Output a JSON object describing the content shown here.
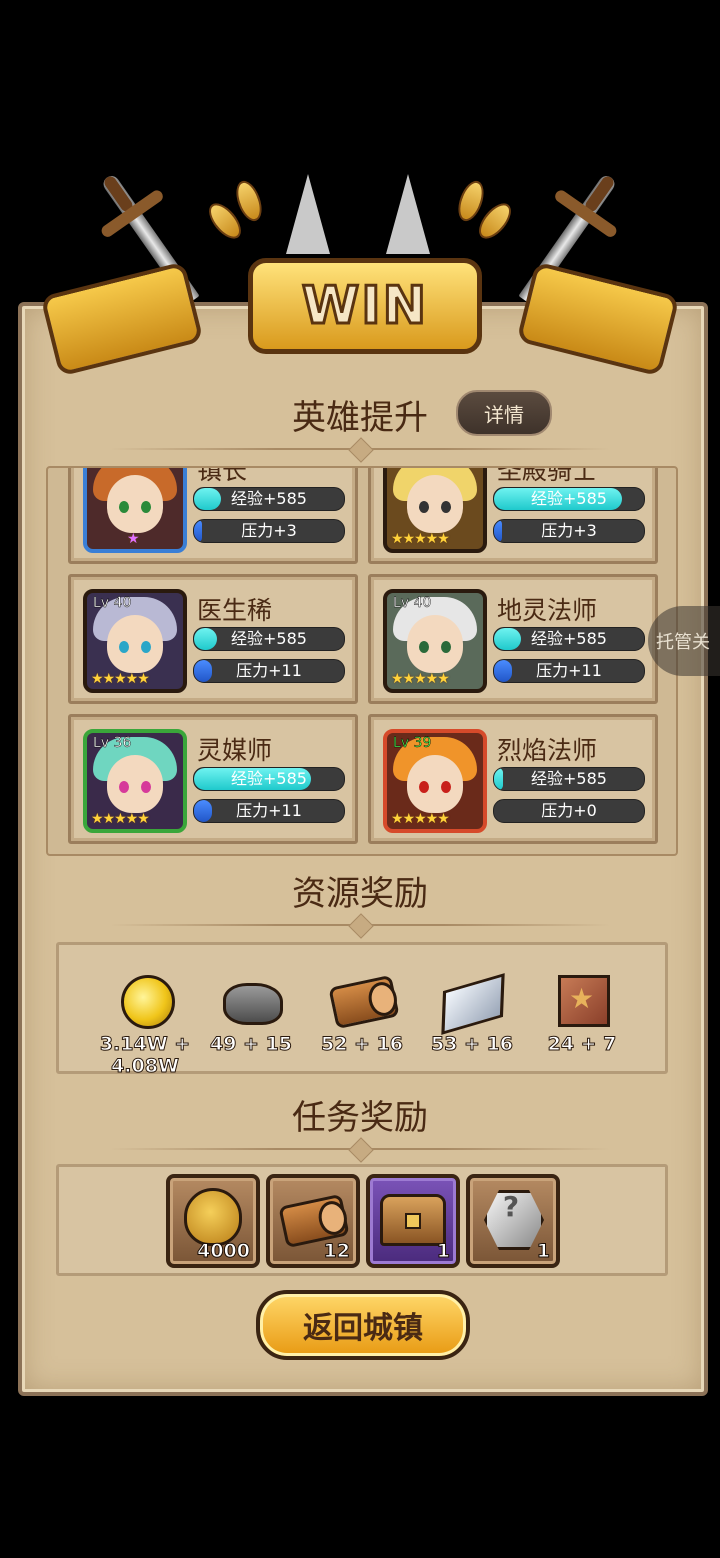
{
  "banner": {
    "title": "WIN"
  },
  "hero_section": {
    "title": "英雄提升",
    "detail_button": "详情",
    "heroes": [
      {
        "name": "镇长",
        "level": "",
        "exp": "经验+585",
        "exp_fill": 0.18,
        "pressure": "压力+3",
        "pressure_fill": 0.05,
        "stars": "★",
        "frame": "#3a7fd6",
        "hair": "#c86a2a"
      },
      {
        "name": "圣殿骑士",
        "level": "",
        "exp": "经验+585",
        "exp_fill": 0.85,
        "pressure": "压力+3",
        "pressure_fill": 0.05,
        "stars": "★★★★★",
        "frame": "#d9a020",
        "hair": "#f0d46a"
      },
      {
        "name": "医生稀",
        "level": "Lv 40",
        "exp": "经验+585",
        "exp_fill": 0.15,
        "pressure": "压力+11",
        "pressure_fill": 0.12,
        "stars": "★★★★★",
        "frame": "#2a1a0e",
        "hair": "#b9b9d4"
      },
      {
        "name": "地灵法师",
        "level": "Lv 40",
        "exp": "经验+585",
        "exp_fill": 0.18,
        "pressure": "压力+11",
        "pressure_fill": 0.12,
        "stars": "★★★★★",
        "frame": "#2a1a0e",
        "hair": "#e6e6e6"
      },
      {
        "name": "灵媒师",
        "level": "Lv 36",
        "exp": "经验+585",
        "exp_fill": 0.78,
        "pressure": "压力+11",
        "pressure_fill": 0.12,
        "stars": "★★★★★",
        "frame": "#3aa63a",
        "hair": "#6fd6c0"
      },
      {
        "name": "烈焰法师",
        "level": "Lv 39",
        "exp": "经验+585",
        "exp_fill": 0.06,
        "pressure": "压力+0",
        "pressure_fill": 0.0,
        "stars": "★★★★★",
        "frame": "#d64a2a",
        "hair": "#f0942a"
      }
    ]
  },
  "resource_section": {
    "title": "资源奖励",
    "items": [
      {
        "icon": "gold-coin-icon",
        "amount": "3.14W + 4.08W"
      },
      {
        "icon": "stone-icon",
        "amount": "49 + 15"
      },
      {
        "icon": "wood-log-icon",
        "amount": "52 + 16"
      },
      {
        "icon": "iron-ingot-icon",
        "amount": "53 + 16"
      },
      {
        "icon": "leather-scroll-icon",
        "amount": "24 + 7"
      }
    ]
  },
  "task_section": {
    "title": "任务奖励",
    "items": [
      {
        "icon": "gold-bag-icon",
        "count": "4000"
      },
      {
        "icon": "wood-log-icon",
        "count": "12"
      },
      {
        "icon": "treasure-chest-icon",
        "count": "1"
      },
      {
        "icon": "mystery-gem-icon",
        "count": "1"
      }
    ]
  },
  "return_button": "返回城镇",
  "auto_toggle": "托管关"
}
